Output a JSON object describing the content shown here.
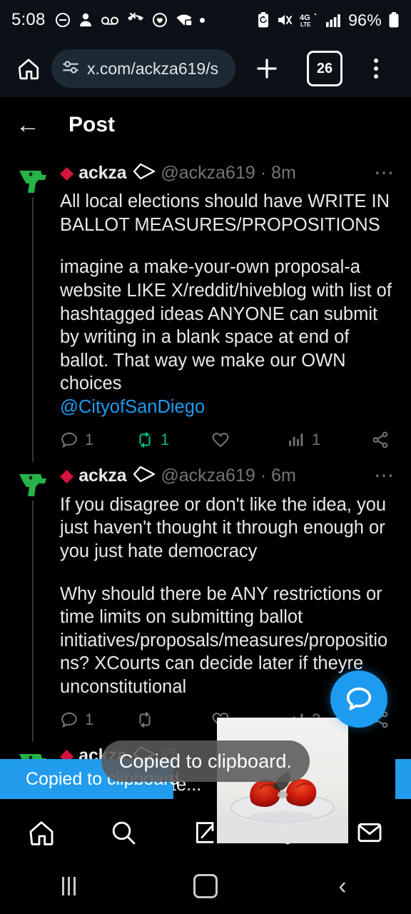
{
  "status_bar": {
    "time": "5:08",
    "left_icons": [
      "do-not-disturb-icon",
      "contact-icon",
      "voicemail-icon",
      "missed-call-icon",
      "heart-clock-icon",
      "wifi-icon",
      "dot-icon"
    ],
    "right_icons": [
      "battery-saver-icon",
      "mute-icon",
      "4g-lte-icon",
      "signal-bars-icon"
    ],
    "network": "4G LTE",
    "battery_percent": "96%"
  },
  "browser": {
    "home_icon": "home-icon",
    "site_settings_icon": "tune-icon",
    "url": "x.com/ackza619/s",
    "new_tab_icon": "plus-icon",
    "tab_count": "26",
    "menu_icon": "kebab-menu-icon"
  },
  "app_header": {
    "back_icon": "arrow-left-icon",
    "title": "Post"
  },
  "posts": [
    {
      "avatar": "green-pistol-emoji-avatar",
      "display_name": "ackza",
      "badge_left": "red-diamond-icon",
      "badge_right": "white-kite-icon",
      "handle": "@ackza619",
      "separator": "·",
      "timestamp": "8m",
      "more_icon": "more-options-icon",
      "paragraphs": [
        "All local elections should have WRITE IN BALLOT MEASURES/PROPOSITIONS",
        "imagine a make-your-own proposal-a website LIKE X/reddit/hiveblog with list of hashtagged ideas ANYONE can submit by writing in a blank space at end of ballot. That way we make our OWN choices "
      ],
      "mention": "@CityofSanDiego",
      "actions": {
        "reply_count": "1",
        "repost_count": "1",
        "like_count": "",
        "views_count": "1",
        "repost_active": true
      }
    },
    {
      "avatar": "green-pistol-emoji-avatar",
      "display_name": "ackza",
      "badge_left": "red-diamond-icon",
      "badge_right": "white-kite-icon",
      "handle": "@ackza619",
      "separator": "·",
      "timestamp": "6m",
      "more_icon": "more-options-icon",
      "paragraphs": [
        "If you disagree or don't like the idea, you just haven't thought it through enough or you just hate democracy",
        "Why should there be ANY restrictions or time limits on submitting ballot initiatives/proposals/measures/propositions? XCourts can decide later if theyre unconstitutional"
      ],
      "mention": "",
      "actions": {
        "reply_count": "1",
        "repost_count": "",
        "like_count": "",
        "views_count": "2",
        "repost_active": false
      }
    },
    {
      "avatar": "green-pistol-emoji-avatar",
      "display_name": "ackza",
      "badge_left": "red-diamond-icon",
      "badge_right": "white-kite-icon",
      "handle": "@",
      "separator": "",
      "timestamp": "",
      "more_icon": "more-options-icon",
      "paragraphs": [
        "Or sign...by filte..."
      ],
      "mention": "",
      "actions": {
        "reply_count": "",
        "repost_count": "",
        "like_count": "",
        "views_count": "",
        "repost_active": false
      }
    }
  ],
  "icons": {
    "reply": "reply-icon",
    "repost": "repost-icon",
    "like": "like-heart-icon",
    "views": "views-bars-icon",
    "share": "share-icon"
  },
  "fab": {
    "icon": "chat-bubble-icon",
    "color": "#1d9bf0"
  },
  "media": {
    "type": "video-thumbnail",
    "description": "red roses on a glass plate"
  },
  "snackbar": {
    "text": "Copied to clipboard",
    "color": "#229ced"
  },
  "toast": {
    "text": "Copied to clipboard."
  },
  "bottom_nav": {
    "items": [
      {
        "name": "home",
        "icon": "home-icon"
      },
      {
        "name": "search",
        "icon": "search-icon"
      },
      {
        "name": "grok",
        "icon": "grok-icon"
      },
      {
        "name": "notifications",
        "icon": "bell-icon"
      },
      {
        "name": "messages",
        "icon": "mail-icon"
      }
    ]
  },
  "system_nav": {
    "recents_icon": "recents-icon",
    "home_icon": "home-square-icon",
    "back_icon": "back-chevron-icon"
  }
}
